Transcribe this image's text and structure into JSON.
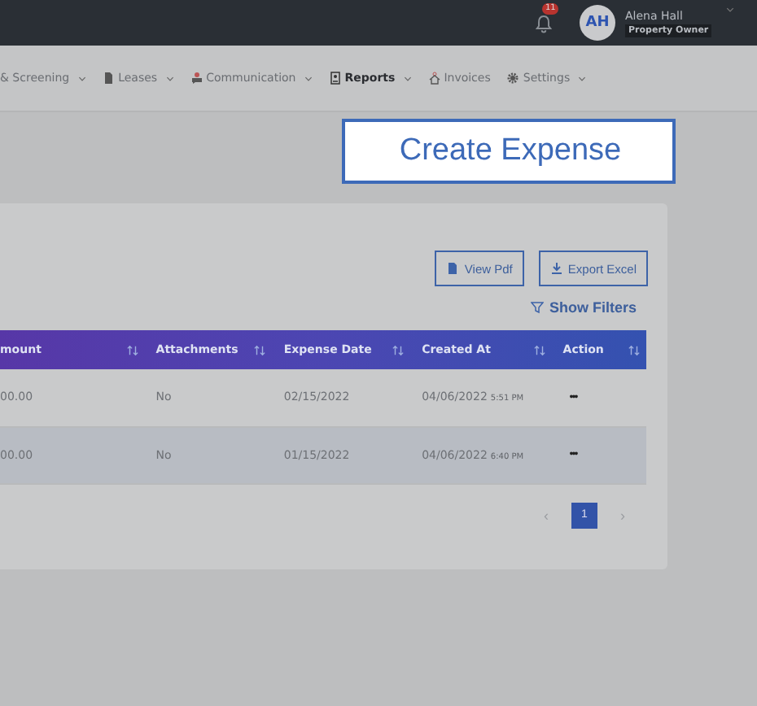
{
  "topbar": {
    "notification_count": "11",
    "user": {
      "initials": "AH",
      "name": "Alena Hall",
      "role": "Property Owner"
    }
  },
  "nav": [
    {
      "label": "& Screening",
      "dropdown": true,
      "selected": false
    },
    {
      "label": "Leases",
      "dropdown": true,
      "selected": false
    },
    {
      "label": "Communication",
      "dropdown": true,
      "selected": false
    },
    {
      "label": "Reports",
      "dropdown": true,
      "selected": true
    },
    {
      "label": "Invoices",
      "dropdown": false,
      "selected": false
    },
    {
      "label": "Settings",
      "dropdown": true,
      "selected": false
    }
  ],
  "create_button": "Create Expense",
  "toolbar": {
    "view_pdf": "View Pdf",
    "export_excel": "Export Excel",
    "show_filters": "Show Filters"
  },
  "table": {
    "columns": [
      "mount",
      "Attachments",
      "Expense Date",
      "Created At",
      "Action"
    ],
    "rows": [
      {
        "amount": "00.00",
        "attachments": "No",
        "expense_date": "02/15/2022",
        "created_date": "04/06/2022",
        "created_time": "5:51 PM",
        "action": "•••",
        "selected": false
      },
      {
        "amount": "00.00",
        "attachments": "No",
        "expense_date": "01/15/2022",
        "created_date": "04/06/2022",
        "created_time": "6:40 PM",
        "action": "•••",
        "selected": true
      }
    ]
  },
  "pagination": {
    "prev": "‹",
    "pages": [
      {
        "label": "1",
        "selected": true
      }
    ],
    "next": "›"
  }
}
